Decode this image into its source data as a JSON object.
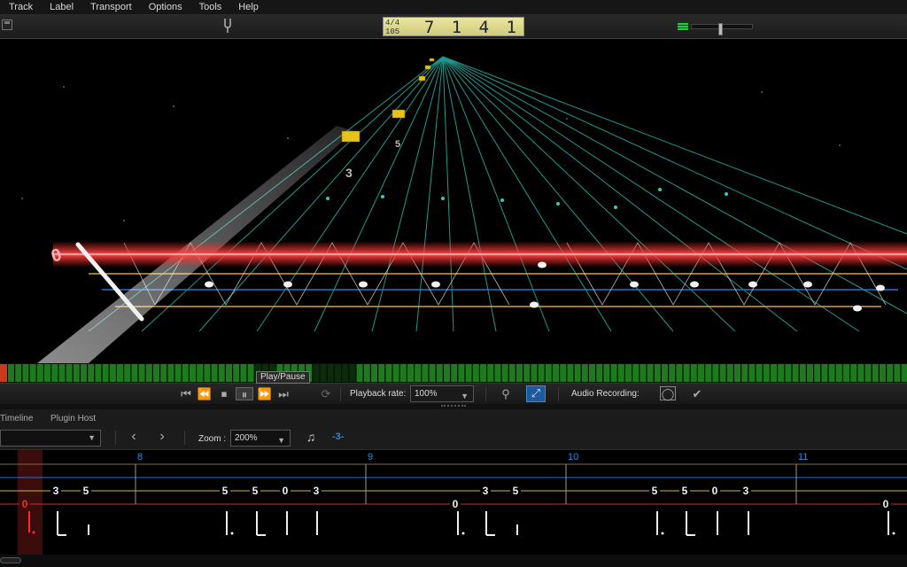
{
  "menu": [
    "Track",
    "Label",
    "Transport",
    "Options",
    "Tools",
    "Help"
  ],
  "lcd": {
    "time_signature": "4/4",
    "tempo": "105",
    "position": "7 1 4 1"
  },
  "volume": {
    "level": 0.45
  },
  "transport": {
    "tooltip": "Play/Pause",
    "playback_rate_label": "Playback rate:",
    "playback_rate": "100%",
    "audio_recording_label": "Audio Recording:"
  },
  "tabs": {
    "timeline": "Timeline",
    "plugin_host": "Plugin Host"
  },
  "editor": {
    "zoom_label": "Zoom :",
    "zoom": "200%",
    "tuplet": "-3-"
  },
  "highway": {
    "fret_labels": [
      "0",
      "3",
      "5"
    ]
  },
  "tab": {
    "measures": [
      "8",
      "9",
      "10",
      "11"
    ],
    "g_string_numbers": [
      "3",
      "5",
      "5",
      "5",
      "0",
      "3",
      "3",
      "5",
      "5",
      "5",
      "0",
      "3"
    ],
    "e_string_numbers": [
      "0",
      "0",
      "0"
    ],
    "colors": {
      "accent": "#2a8ae0",
      "active": "#e02020",
      "string_g": "#d6b23a",
      "string_a": "#2d72c8",
      "string_e": "#cc3030"
    }
  }
}
